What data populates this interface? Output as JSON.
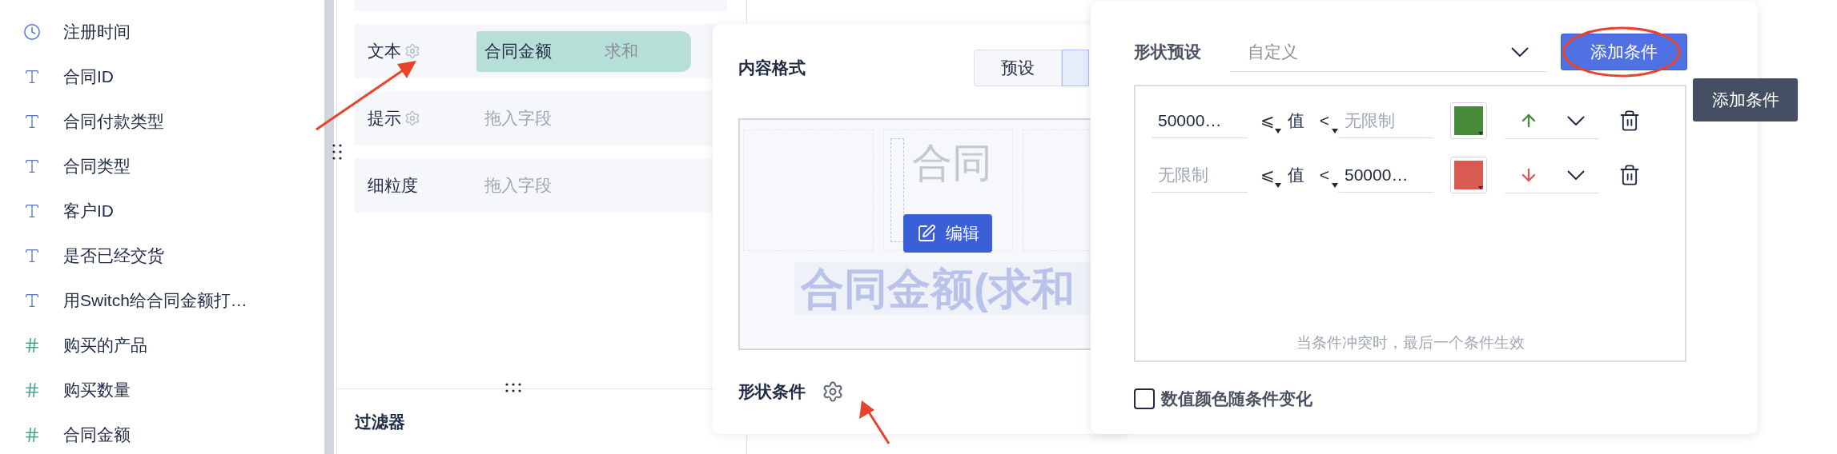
{
  "field_list": [
    {
      "kind": "date",
      "label": "注册时间"
    },
    {
      "kind": "text",
      "label": "合同ID"
    },
    {
      "kind": "text",
      "label": "合同付款类型"
    },
    {
      "kind": "text",
      "label": "合同类型"
    },
    {
      "kind": "text",
      "label": "客户ID"
    },
    {
      "kind": "text",
      "label": "是否已经交货"
    },
    {
      "kind": "text",
      "label": "用Switch给合同金额打…"
    },
    {
      "kind": "number",
      "label": "购买的产品"
    },
    {
      "kind": "number",
      "label": "购买数量"
    },
    {
      "kind": "number",
      "label": "合同金额"
    }
  ],
  "encoding_rows": [
    {
      "label": "文本",
      "settings": true,
      "field": "合同金额",
      "aggregate": "求和"
    },
    {
      "label": "提示",
      "settings": true,
      "placeholder": "拖入字段"
    },
    {
      "label": "细粒度",
      "settings": false,
      "placeholder": "拖入字段"
    }
  ],
  "filter_section": {
    "title": "过滤器"
  },
  "format_panel": {
    "title": "内容格式",
    "segments": [
      {
        "label": "预设",
        "selected": false
      },
      {
        "selected": true
      }
    ],
    "preview": {
      "cell_text": "合同",
      "edit_button": "编辑",
      "title_text": "合同金额(求和"
    },
    "shape_conditions_label": "形状条件"
  },
  "condition_panel": {
    "preset_label": "形状预设",
    "preset_value": "自定义",
    "add_button": "添加条件",
    "tooltip": "添加条件",
    "conditions": [
      {
        "lower": {
          "value": "50000…"
        },
        "lower_op": "⩽",
        "subject": "值",
        "upper_op": "<",
        "upper": {
          "placeholder": "无限制"
        },
        "color": "#478a3a",
        "kind": "up"
      },
      {
        "lower": {
          "placeholder": "无限制"
        },
        "lower_op": "⩽",
        "subject": "值",
        "upper_op": "<",
        "upper": {
          "value": "50000…"
        },
        "color": "#d95a50",
        "kind": "down"
      }
    ],
    "hint": "当条件冲突时，最后一个条件生效",
    "value_color_follows": {
      "label": "数值颜色随条件变化",
      "checked": false
    }
  }
}
